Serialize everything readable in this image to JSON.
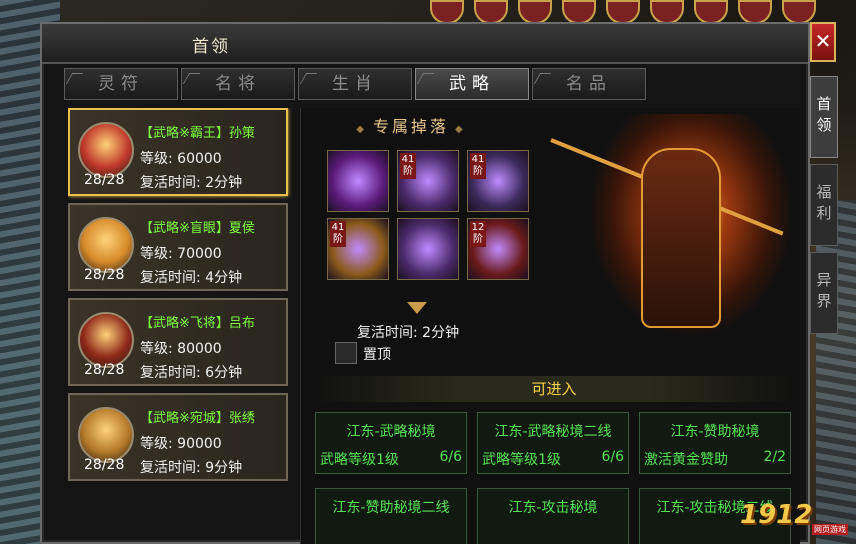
{
  "window": {
    "title": "首领",
    "close_label": "✕"
  },
  "side_tabs": [
    {
      "label": "首领",
      "active": true
    },
    {
      "label": "福利",
      "active": false
    },
    {
      "label": "异界",
      "active": false
    }
  ],
  "tabs": [
    {
      "label": "灵符",
      "active": false
    },
    {
      "label": "名将",
      "active": false
    },
    {
      "label": "生肖",
      "active": false
    },
    {
      "label": "武略",
      "active": true
    },
    {
      "label": "名品",
      "active": false
    }
  ],
  "bosses": [
    {
      "name": "【武略※霸王】孙策",
      "level": "等级: 60000",
      "count": "28/28",
      "respawn": "复活时间: 2分钟",
      "selected": true,
      "color": "#c0392b"
    },
    {
      "name": "【武略※盲眼】夏侯",
      "level": "等级: 70000",
      "count": "28/28",
      "respawn": "复活时间: 4分钟",
      "selected": false,
      "color": "#d68a2a"
    },
    {
      "name": "【武略※飞将】吕布",
      "level": "等级: 80000",
      "count": "28/28",
      "respawn": "复活时间: 6分钟",
      "selected": false,
      "color": "#8e2a1a"
    },
    {
      "name": "【武略※宛城】张绣",
      "level": "等级: 90000",
      "count": "28/28",
      "respawn": "复活时间: 9分钟",
      "selected": false,
      "color": "#b57a2a"
    }
  ],
  "detail": {
    "drops_title": "专属掉落",
    "items": [
      {
        "icon": "flame-gem-icon",
        "tag": "",
        "color": "#5a1a7a"
      },
      {
        "icon": "purple-blade-icon",
        "tag": "41阶",
        "color": "#4a2a6a"
      },
      {
        "icon": "winged-armor-icon",
        "tag": "41阶",
        "color": "#3a2a5a"
      },
      {
        "icon": "golden-wings-icon",
        "tag": "41阶",
        "color": "#8a5a1a"
      },
      {
        "icon": "chariot-icon",
        "tag": "",
        "color": "#4a2a6a"
      },
      {
        "icon": "general-portrait-icon",
        "tag": "12阶",
        "color": "#6a1a1a"
      }
    ],
    "respawn": "复活时间: 2分钟",
    "pin_label": "置顶",
    "enter_header": "可进入"
  },
  "realms": [
    {
      "name": "江东-武略秘境",
      "req": "武略等级1级",
      "progress": "6/6"
    },
    {
      "name": "江东-武略秘境二线",
      "req": "武略等级1级",
      "progress": "6/6"
    },
    {
      "name": "江东-赞助秘境",
      "req": "激活黄金赞助",
      "progress": "2/2"
    },
    {
      "name": "江东-赞助秘境二线",
      "req": "",
      "progress": ""
    },
    {
      "name": "江东-攻击秘境",
      "req": "",
      "progress": ""
    },
    {
      "name": "江东-攻击秘境二线",
      "req": "",
      "progress": ""
    }
  ],
  "branding": {
    "logo": "1912",
    "sub": "网页游戏"
  }
}
